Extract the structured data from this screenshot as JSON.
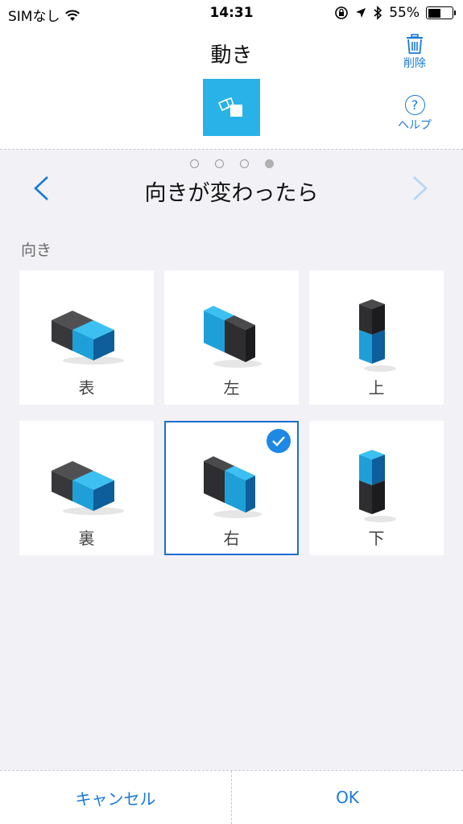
{
  "status_bar": {
    "carrier": "SIMなし",
    "time": "14:31",
    "battery": "55%",
    "battery_level": 0.55
  },
  "header": {
    "title": "動き",
    "delete_label": "削除",
    "help_label": "ヘルプ",
    "help_symbol": "?",
    "accent_color": "#29b2e8"
  },
  "pager": {
    "count": 4,
    "active_index": 3
  },
  "step": {
    "title": "向きが変わったら"
  },
  "orientation": {
    "section_label": "向き",
    "options": [
      {
        "label": "表",
        "icon": "face-up-cube-icon",
        "selected": false
      },
      {
        "label": "左",
        "icon": "left-side-cube-icon",
        "selected": false
      },
      {
        "label": "上",
        "icon": "top-side-cube-icon",
        "selected": false
      },
      {
        "label": "裏",
        "icon": "face-down-cube-icon",
        "selected": false
      },
      {
        "label": "右",
        "icon": "right-side-cube-icon",
        "selected": true
      },
      {
        "label": "下",
        "icon": "bottom-side-cube-icon",
        "selected": false
      }
    ]
  },
  "footer": {
    "cancel_label": "キャンセル",
    "ok_label": "OK"
  }
}
